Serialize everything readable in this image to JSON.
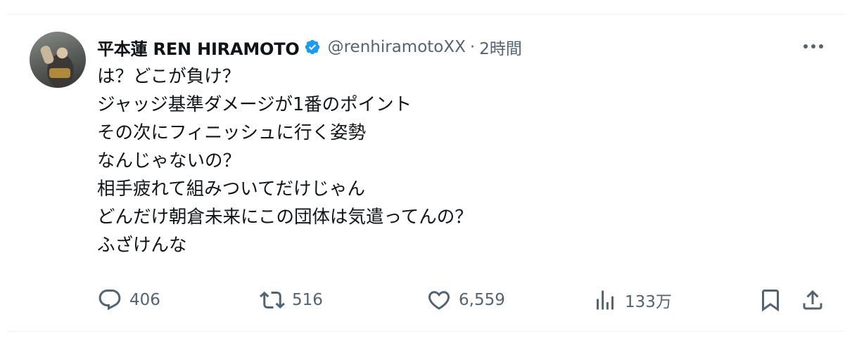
{
  "post": {
    "author_name": "平本蓮 REN HIRAMOTO",
    "handle": "@renhiramotoXX",
    "separator": "·",
    "time": "2時間",
    "lines": [
      "は？どこが負け？",
      "ジャッジ基準ダメージが1番のポイント",
      "その次にフィニッシュに行く姿勢",
      "なんじゃないの？",
      "相手疲れて組みついてだけじゃん",
      "どんだけ朝倉未来にこの団体は気遣ってんの？",
      "ふざけんな"
    ]
  },
  "actions": {
    "replies": "406",
    "reposts": "516",
    "likes": "6,559",
    "views": "133万"
  },
  "icons": {
    "verified": "verified-badge-icon",
    "more": "more-icon",
    "reply": "reply-icon",
    "repost": "repost-icon",
    "like": "heart-icon",
    "views": "views-icon",
    "bookmark": "bookmark-icon",
    "share": "share-icon"
  },
  "colors": {
    "verified_blue": "#1d9bf0",
    "text": "#0f1419",
    "secondary": "#536471"
  }
}
